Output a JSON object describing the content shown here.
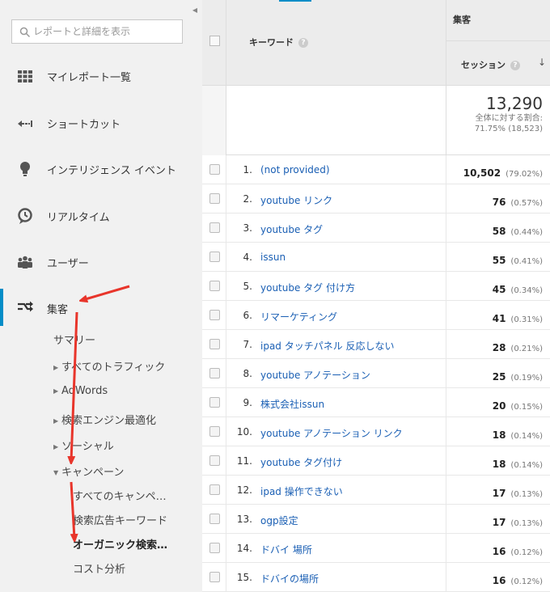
{
  "sidebar": {
    "search_placeholder": "レポートと詳細を表示",
    "nav_items": [
      {
        "label": "マイレポート一覧",
        "icon": "grid-icon"
      },
      {
        "label": "ショートカット",
        "icon": "shortcut-arrow-icon"
      },
      {
        "label": "インテリジェンス イベント",
        "icon": "lightbulb-icon"
      },
      {
        "label": "リアルタイム",
        "icon": "clock-icon"
      },
      {
        "label": "ユーザー",
        "icon": "users-icon"
      },
      {
        "label": "集客",
        "icon": "acquisition-arrows-icon"
      }
    ],
    "sub_items": {
      "summary": "サマリー",
      "all_traffic": "すべてのトラフィック",
      "adwords": "AdWords",
      "seo": "検索エンジン最適化",
      "social": "ソーシャル",
      "campaigns": "キャンペーン",
      "all_campaigns": "すべてのキャンペ…",
      "paid_keywords": "検索広告キーワード",
      "organic": "オーガニック検索…",
      "cost_analysis": "コスト分析"
    }
  },
  "table": {
    "keyword_header": "キーワード",
    "group_header": "集客",
    "sessions_header": "セッション",
    "summary": {
      "total": "13,290",
      "share_label": "全体に対する割合:",
      "share_value": "71.75% (18,523)"
    },
    "rows": [
      {
        "idx": "1.",
        "kw": "(not provided)",
        "val": "10,502",
        "pct": "(79.02%)"
      },
      {
        "idx": "2.",
        "kw": "youtube リンク",
        "val": "76",
        "pct": "(0.57%)"
      },
      {
        "idx": "3.",
        "kw": "youtube タグ",
        "val": "58",
        "pct": "(0.44%)"
      },
      {
        "idx": "4.",
        "kw": "issun",
        "val": "55",
        "pct": "(0.41%)"
      },
      {
        "idx": "5.",
        "kw": "youtube タグ 付け方",
        "val": "45",
        "pct": "(0.34%)"
      },
      {
        "idx": "6.",
        "kw": "リマーケティング",
        "val": "41",
        "pct": "(0.31%)"
      },
      {
        "idx": "7.",
        "kw": "ipad タッチパネル 反応しない",
        "val": "28",
        "pct": "(0.21%)"
      },
      {
        "idx": "8.",
        "kw": "youtube アノテーション",
        "val": "25",
        "pct": "(0.19%)"
      },
      {
        "idx": "9.",
        "kw": "株式会社issun",
        "val": "20",
        "pct": "(0.15%)"
      },
      {
        "idx": "10.",
        "kw": "youtube アノテーション リンク",
        "val": "18",
        "pct": "(0.14%)"
      },
      {
        "idx": "11.",
        "kw": "youtube タグ付け",
        "val": "18",
        "pct": "(0.14%)"
      },
      {
        "idx": "12.",
        "kw": "ipad 操作できない",
        "val": "17",
        "pct": "(0.13%)"
      },
      {
        "idx": "13.",
        "kw": "ogp設定",
        "val": "17",
        "pct": "(0.13%)"
      },
      {
        "idx": "14.",
        "kw": "ドバイ 場所",
        "val": "16",
        "pct": "(0.12%)"
      },
      {
        "idx": "15.",
        "kw": "ドバイの場所",
        "val": "16",
        "pct": "(0.12%)"
      }
    ]
  },
  "colors": {
    "link": "#1a5fb4",
    "active_bar": "#058dc7",
    "annotation_arrow": "#e8352b"
  }
}
